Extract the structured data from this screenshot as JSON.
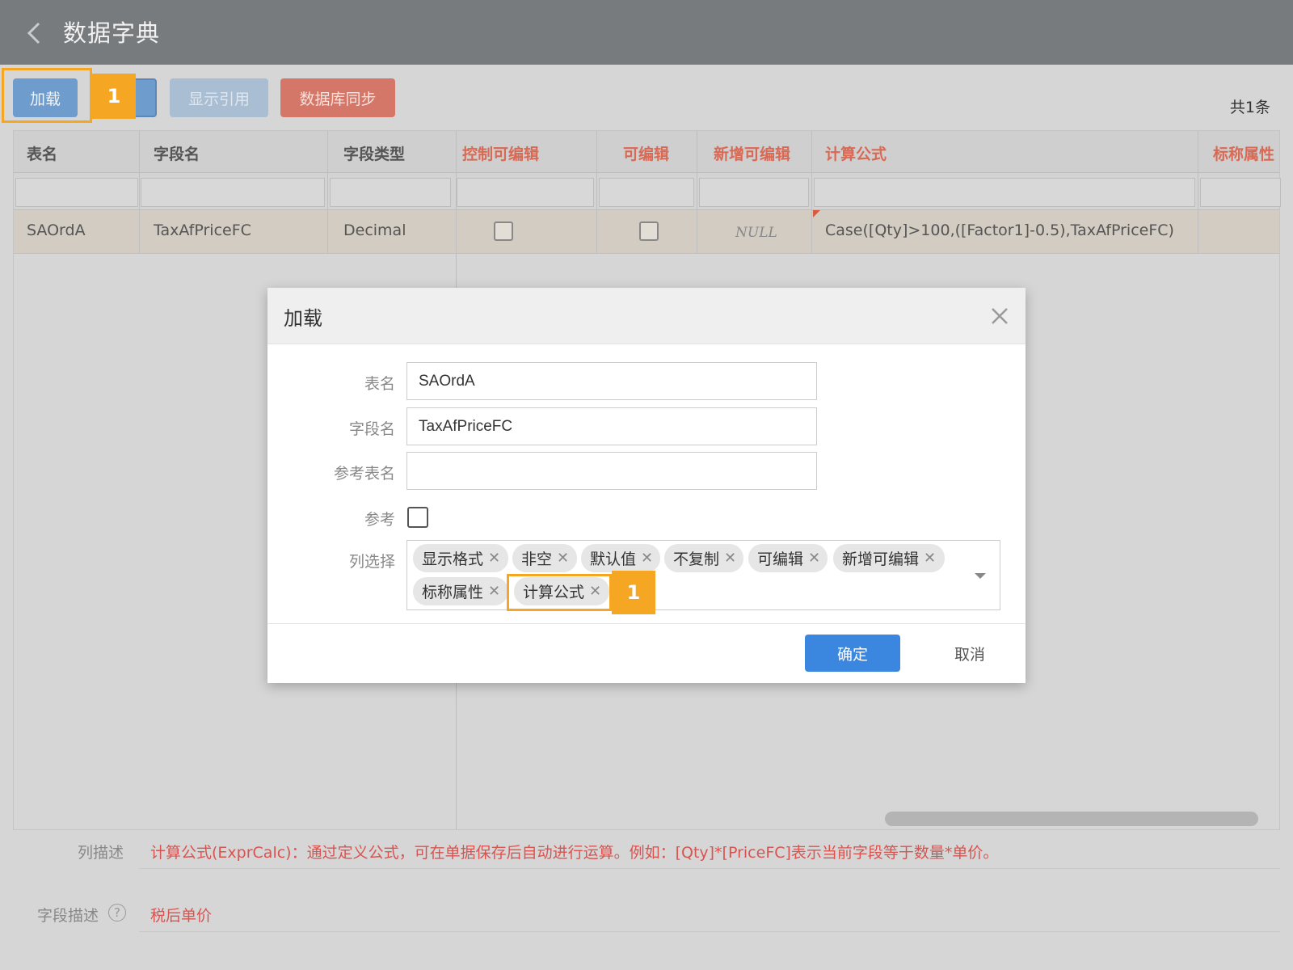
{
  "header": {
    "title": "数据字典"
  },
  "toolbar": {
    "load_label": "加载",
    "hidden_button_stub": " ",
    "show_refs_label": "显示引用",
    "db_sync_label": "数据库同步",
    "total_label": "共1条"
  },
  "callouts": {
    "toolbar_step": "1",
    "tag_step": "1"
  },
  "colors": {
    "highlight": "#f5a623",
    "primary": "#3b87e0",
    "danger": "#d86a55"
  },
  "grid": {
    "columns": [
      "表名",
      "字段名",
      "字段类型",
      "控制可编辑",
      "可编辑",
      "新增可编辑",
      "计算公式",
      "标称属性"
    ],
    "rows": [
      {
        "table_name": "SAOrdA",
        "field_name": "TaxAfPriceFC",
        "field_type": "Decimal",
        "control_editable": false,
        "editable": false,
        "new_editable": "NULL",
        "formula": "Case([Qty]>100,([Factor1]-0.5),TaxAfPriceFC)"
      }
    ]
  },
  "column_description": {
    "label": "列描述",
    "text": "计算公式(ExprCalc)：通过定义公式，可在单据保存后自动进行运算。例如：[Qty]*[PriceFC]表示当前字段等于数量*单价。"
  },
  "field_description": {
    "label": "字段描述",
    "text": "税后单价"
  },
  "dialog": {
    "title": "加载",
    "table_name_label": "表名",
    "table_name_value": "SAOrdA",
    "field_name_label": "字段名",
    "field_name_value": "TaxAfPriceFC",
    "ref_table_label": "参考表名",
    "ref_table_value": "",
    "ref_label": "参考",
    "ref_checked": false,
    "column_select_label": "列选择",
    "selected_columns": [
      "显示格式",
      "非空",
      "默认值",
      "不复制",
      "可编辑",
      "新增可编辑",
      "标称属性",
      "计算公式"
    ],
    "ok_label": "确定",
    "cancel_label": "取消"
  }
}
